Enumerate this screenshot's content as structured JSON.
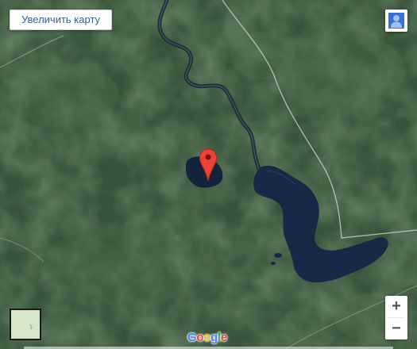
{
  "controls": {
    "enlarge_label": "Увеличить карту",
    "zoom_in": "+",
    "zoom_out": "−"
  },
  "logo": {
    "letters": [
      "G",
      "o",
      "o",
      "g",
      "l",
      "e"
    ],
    "colors": [
      "#4285F4",
      "#EA4335",
      "#FBBC05",
      "#4285F4",
      "#34A853",
      "#EA4335"
    ]
  },
  "icons": {
    "streetview": "pegman-icon",
    "marker": "location-pin-icon",
    "minimap": "map-type-thumbnail"
  },
  "colors": {
    "forest": "#2f4a31",
    "water": "#1a2746",
    "marker": "#ea4335",
    "road": "#c9ccc5"
  }
}
